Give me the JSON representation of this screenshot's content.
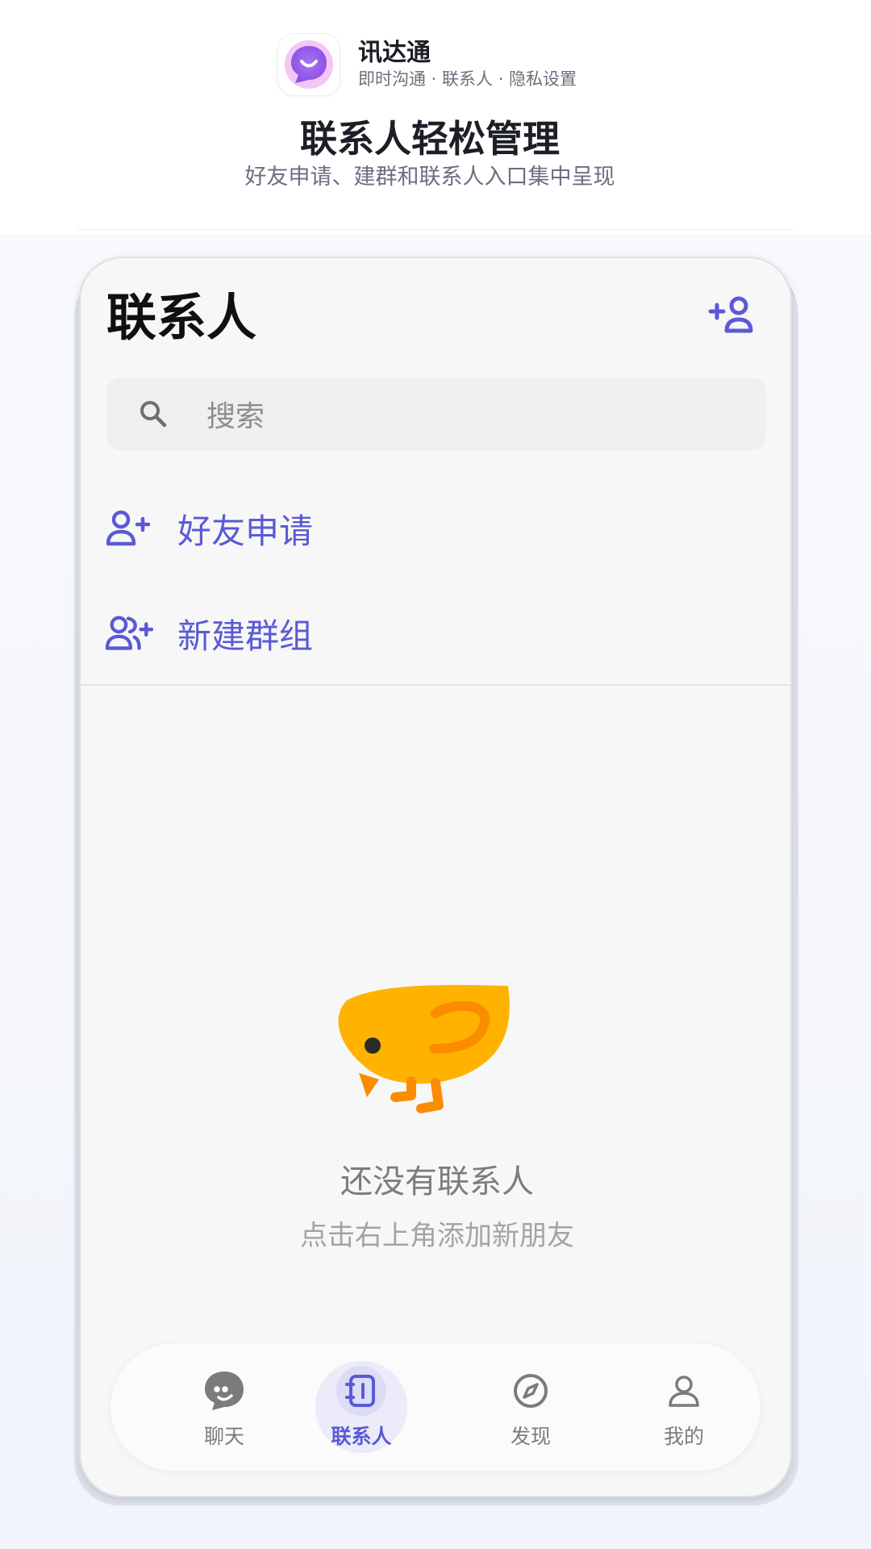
{
  "header": {
    "app_name": "讯达通",
    "tagline": "即时沟通 · 联系人 · 隐私设置",
    "hero_title": "联系人轻松管理",
    "hero_subtitle": "好友申请、建群和联系人入口集中呈现",
    "logo_icon": "smile-chat-bubble-icon"
  },
  "screen": {
    "title": "联系人",
    "add_contact_icon": "person-add-icon",
    "search": {
      "placeholder": "搜索",
      "icon": "search-icon"
    },
    "actions": [
      {
        "label": "好友申请",
        "icon": "person-add-icon"
      },
      {
        "label": "新建群组",
        "icon": "group-add-icon"
      }
    ],
    "empty_state": {
      "illustration": "chick-icon",
      "title": "还没有联系人",
      "subtitle": "点击右上角添加新朋友"
    }
  },
  "bottom_nav": {
    "items": [
      {
        "label": "聊天",
        "icon": "chat-bubble-icon",
        "active": false
      },
      {
        "label": "联系人",
        "icon": "contacts-book-icon",
        "active": true
      },
      {
        "label": "发现",
        "icon": "compass-icon",
        "active": false
      },
      {
        "label": "我的",
        "icon": "person-icon",
        "active": false
      }
    ]
  },
  "colors": {
    "accent": "#5a5ad6",
    "chick_body": "#ffb300",
    "chick_accent": "#fb8c00",
    "screen_bg": "#f7f7f7"
  }
}
